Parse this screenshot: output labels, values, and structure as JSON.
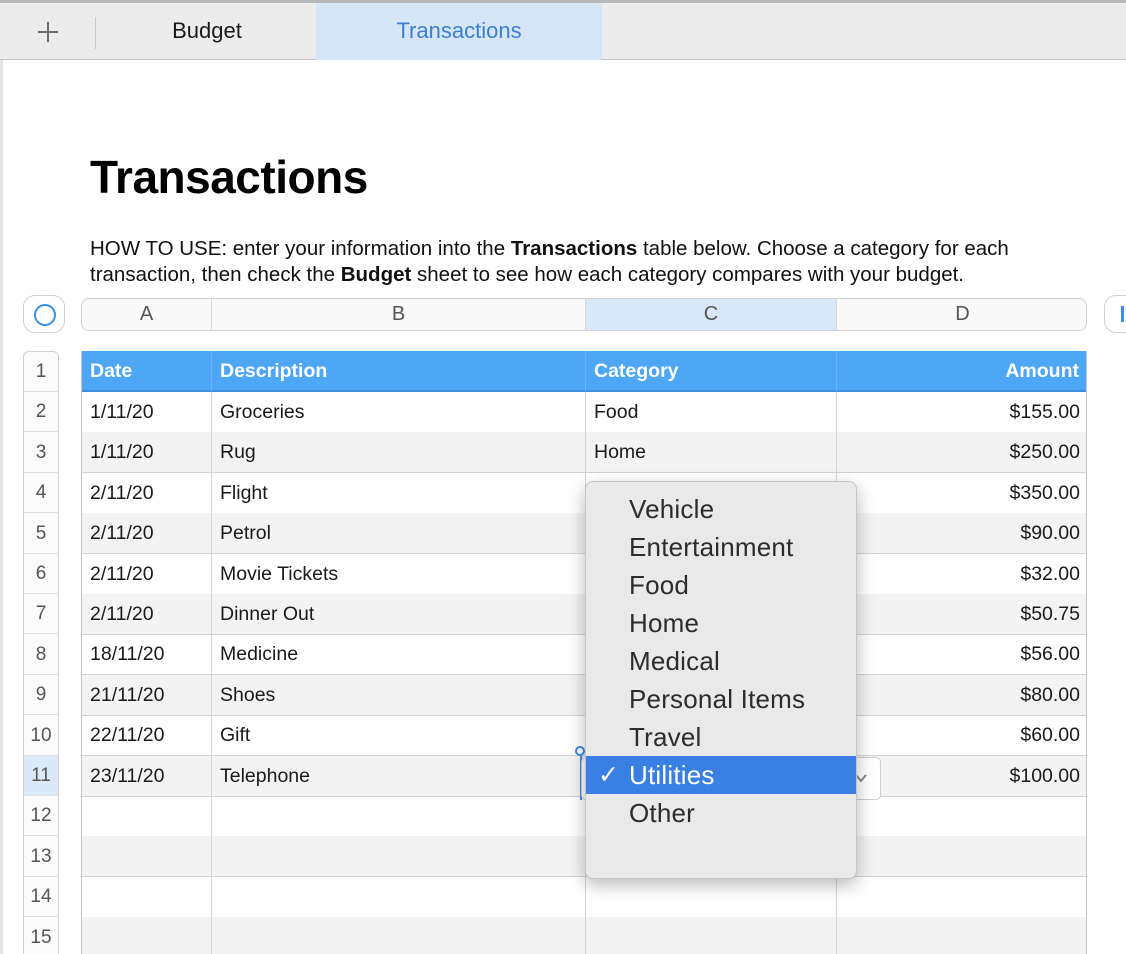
{
  "tabs": {
    "add_label": "+",
    "items": [
      {
        "label": "Budget",
        "active": false
      },
      {
        "label": "Transactions",
        "active": true
      }
    ]
  },
  "sheet": {
    "title": "Transactions",
    "howto_prefix": "HOW TO USE: enter your information into the ",
    "howto_bold1": "Transactions",
    "howto_mid": " table below. Choose a category for each transaction, then check the ",
    "howto_bold2": "Budget",
    "howto_suffix": " sheet to see how each category compares with your budget."
  },
  "columns": [
    "A",
    "B",
    "C",
    "D"
  ],
  "active_column": "C",
  "row_numbers": [
    "1",
    "2",
    "3",
    "4",
    "5",
    "6",
    "7",
    "8",
    "9",
    "10",
    "11",
    "12",
    "13",
    "14",
    "15"
  ],
  "active_row": "11",
  "table": {
    "headers": {
      "date": "Date",
      "description": "Description",
      "category": "Category",
      "amount": "Amount"
    },
    "rows": [
      {
        "date": "1/11/20",
        "description": "Groceries",
        "category": "Food",
        "amount": "$155.00"
      },
      {
        "date": "1/11/20",
        "description": "Rug",
        "category": "Home",
        "amount": "$250.00"
      },
      {
        "date": "2/11/20",
        "description": "Flight",
        "category": "",
        "amount": "$350.00"
      },
      {
        "date": "2/11/20",
        "description": "Petrol",
        "category": "",
        "amount": "$90.00"
      },
      {
        "date": "2/11/20",
        "description": "Movie Tickets",
        "category": "",
        "amount": "$32.00"
      },
      {
        "date": "2/11/20",
        "description": "Dinner Out",
        "category": "",
        "amount": "$50.75"
      },
      {
        "date": "18/11/20",
        "description": "Medicine",
        "category": "",
        "amount": "$56.00"
      },
      {
        "date": "21/11/20",
        "description": "Shoes",
        "category": "",
        "amount": "$80.00"
      },
      {
        "date": "22/11/20",
        "description": "Gift",
        "category": "",
        "amount": "$60.00"
      },
      {
        "date": "23/11/20",
        "description": "Telephone",
        "category": "",
        "amount": "$100.00"
      },
      {
        "date": "",
        "description": "",
        "category": "",
        "amount": ""
      },
      {
        "date": "",
        "description": "",
        "category": "",
        "amount": ""
      },
      {
        "date": "",
        "description": "",
        "category": "",
        "amount": ""
      },
      {
        "date": "",
        "description": "",
        "category": "",
        "amount": ""
      }
    ]
  },
  "category_menu": {
    "options": [
      "Vehicle",
      "Entertainment",
      "Food",
      "Home",
      "Medical",
      "Personal Items",
      "Travel",
      "Utilities",
      "Other"
    ],
    "selected": "Utilities",
    "check_glyph": "✓"
  },
  "colors": {
    "header_fill": "#4ea6f7",
    "accent": "#3b8ee8",
    "menu_highlight": "#3a7fe3",
    "active_tab_fill": "#d6e6f7"
  }
}
